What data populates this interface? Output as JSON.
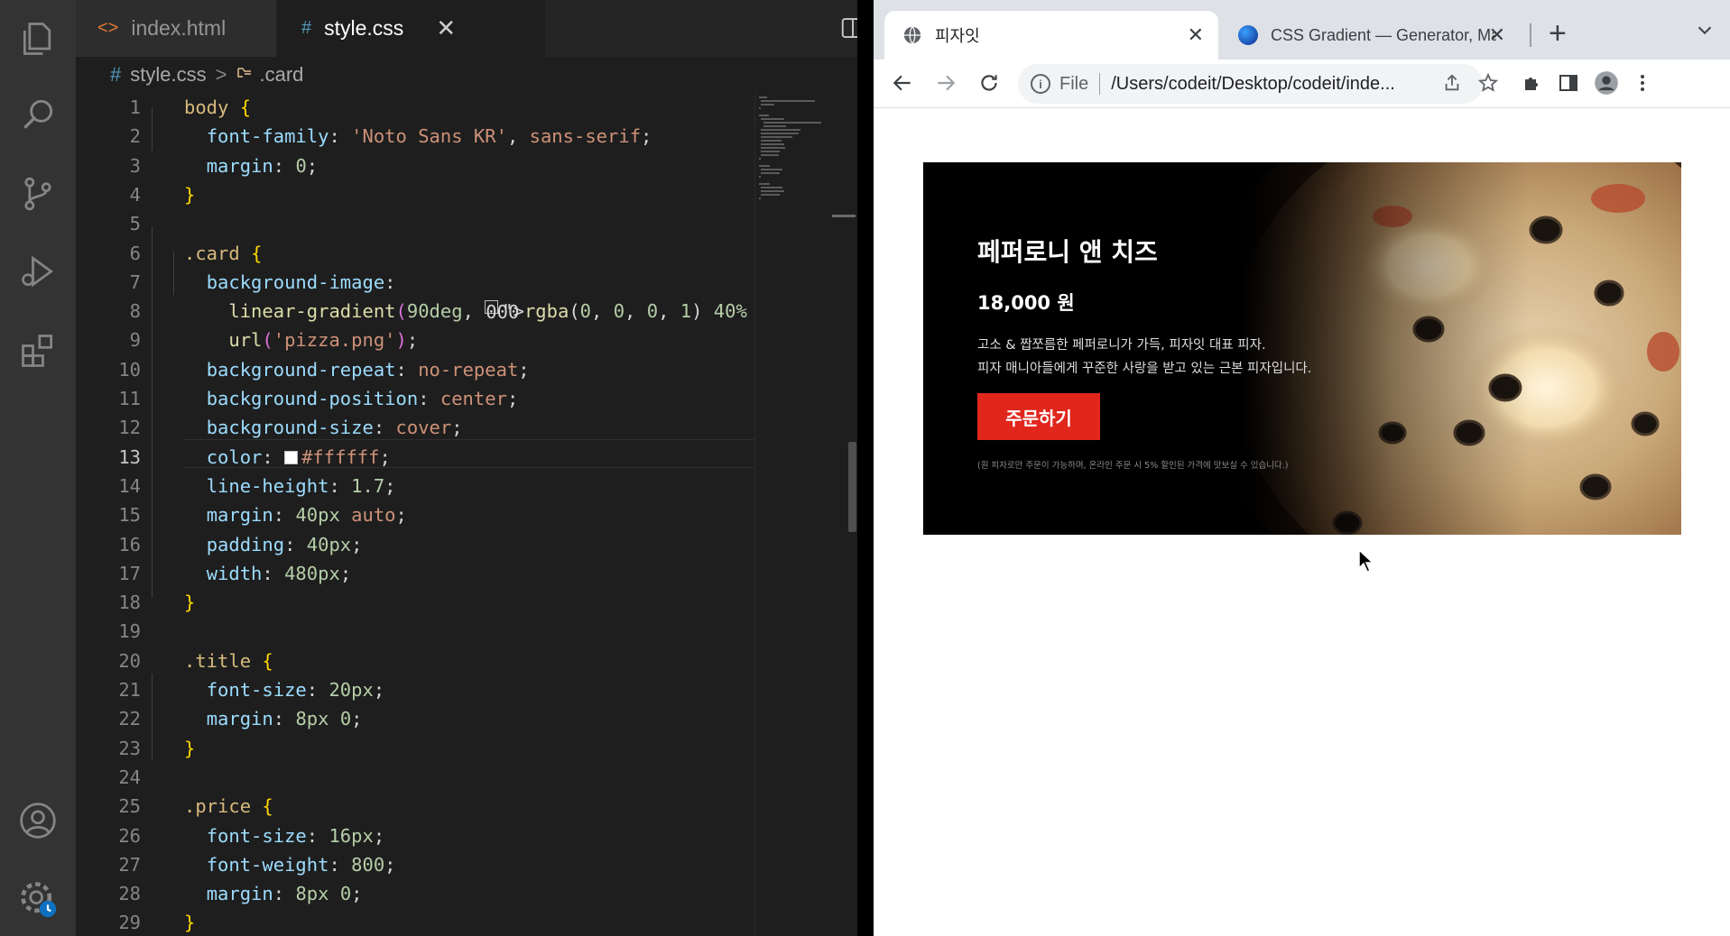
{
  "vscode": {
    "activity_bar": {
      "icons": [
        "explorer-icon",
        "search-icon",
        "source-control-icon",
        "run-debug-icon",
        "extensions-icon",
        "account-icon",
        "manage-gear-icon"
      ]
    },
    "tabs": [
      {
        "glyph": "<>",
        "label": "index.html",
        "active": false
      },
      {
        "glyph": "#",
        "label": "style.css",
        "active": true,
        "close": "✕"
      }
    ],
    "more": "···",
    "breadcrumb": {
      "file_glyph": "#",
      "file": "style.css",
      "separator": ">",
      "symbol": ".card"
    },
    "active_line": 13,
    "lines": [
      {
        "n": "1",
        "text": "body {"
      },
      {
        "n": "2",
        "text": "  font-family: 'Noto Sans KR', sans-serif;"
      },
      {
        "n": "3",
        "text": "  margin: 0;"
      },
      {
        "n": "4",
        "text": "}"
      },
      {
        "n": "5",
        "text": ""
      },
      {
        "n": "6",
        "text": ".card {"
      },
      {
        "n": "7",
        "text": "  background-image:"
      },
      {
        "n": "8",
        "text": "    linear-gradient(90deg, rgba(0, 0, 0, 1) 40%"
      },
      {
        "n": "9",
        "text": "    url('pizza.png');"
      },
      {
        "n": "10",
        "text": "  background-repeat: no-repeat;"
      },
      {
        "n": "11",
        "text": "  background-position: center;"
      },
      {
        "n": "12",
        "text": "  background-size: cover;"
      },
      {
        "n": "13",
        "text": "  color: #ffffff;"
      },
      {
        "n": "14",
        "text": "  line-height: 1.7;"
      },
      {
        "n": "15",
        "text": "  margin: 40px auto;"
      },
      {
        "n": "16",
        "text": "  padding: 40px;"
      },
      {
        "n": "17",
        "text": "  width: 480px;"
      },
      {
        "n": "18",
        "text": "}"
      },
      {
        "n": "19",
        "text": ""
      },
      {
        "n": "20",
        "text": ".title {"
      },
      {
        "n": "21",
        "text": "  font-size: 20px;"
      },
      {
        "n": "22",
        "text": "  margin: 8px 0;"
      },
      {
        "n": "23",
        "text": "}"
      },
      {
        "n": "24",
        "text": ""
      },
      {
        "n": "25",
        "text": ".price {"
      },
      {
        "n": "26",
        "text": "  font-size: 16px;"
      },
      {
        "n": "27",
        "text": "  font-weight: 800;"
      },
      {
        "n": "28",
        "text": "  margin: 8px 0;"
      },
      {
        "n": "29",
        "text": "}"
      }
    ],
    "colors": {
      "background": "#1e1e1e",
      "selector": "#d7ba7d",
      "property": "#9cdcfe",
      "string": "#ce9178",
      "number": "#b5cea8",
      "function": "#dcdcaa",
      "bracket": "#ffd700"
    }
  },
  "browser": {
    "tabs": [
      {
        "title": "피자잇",
        "favicon": "globe-icon",
        "close": "✕",
        "active": true
      },
      {
        "title": "CSS Gradient — Generator, Maker",
        "favicon": "css-gradient-favicon",
        "close": "✕",
        "active": false
      }
    ],
    "new_tab": "+",
    "omnibox": {
      "scheme": "File",
      "url": "/Users/codeit/Desktop/codeit/inde..."
    },
    "page": {
      "card": {
        "title": "페퍼로니 앤 치즈",
        "price": "18,000 원",
        "desc_line1": "고소 & 짭쪼름한 페퍼로니가 가득, 피자잇 대표 피자.",
        "desc_line2": "피자 매니아들에게 꾸준한 사랑을 받고 있는 근본 피자입니다.",
        "button": "주문하기",
        "note": "(원 피자로만 주문이 가능하며, 온라인 주문 시 5% 할인된 가격에 맛보실 수 있습니다.)"
      },
      "colors": {
        "button": "#e1261c",
        "card_bg": "#000000"
      }
    }
  }
}
